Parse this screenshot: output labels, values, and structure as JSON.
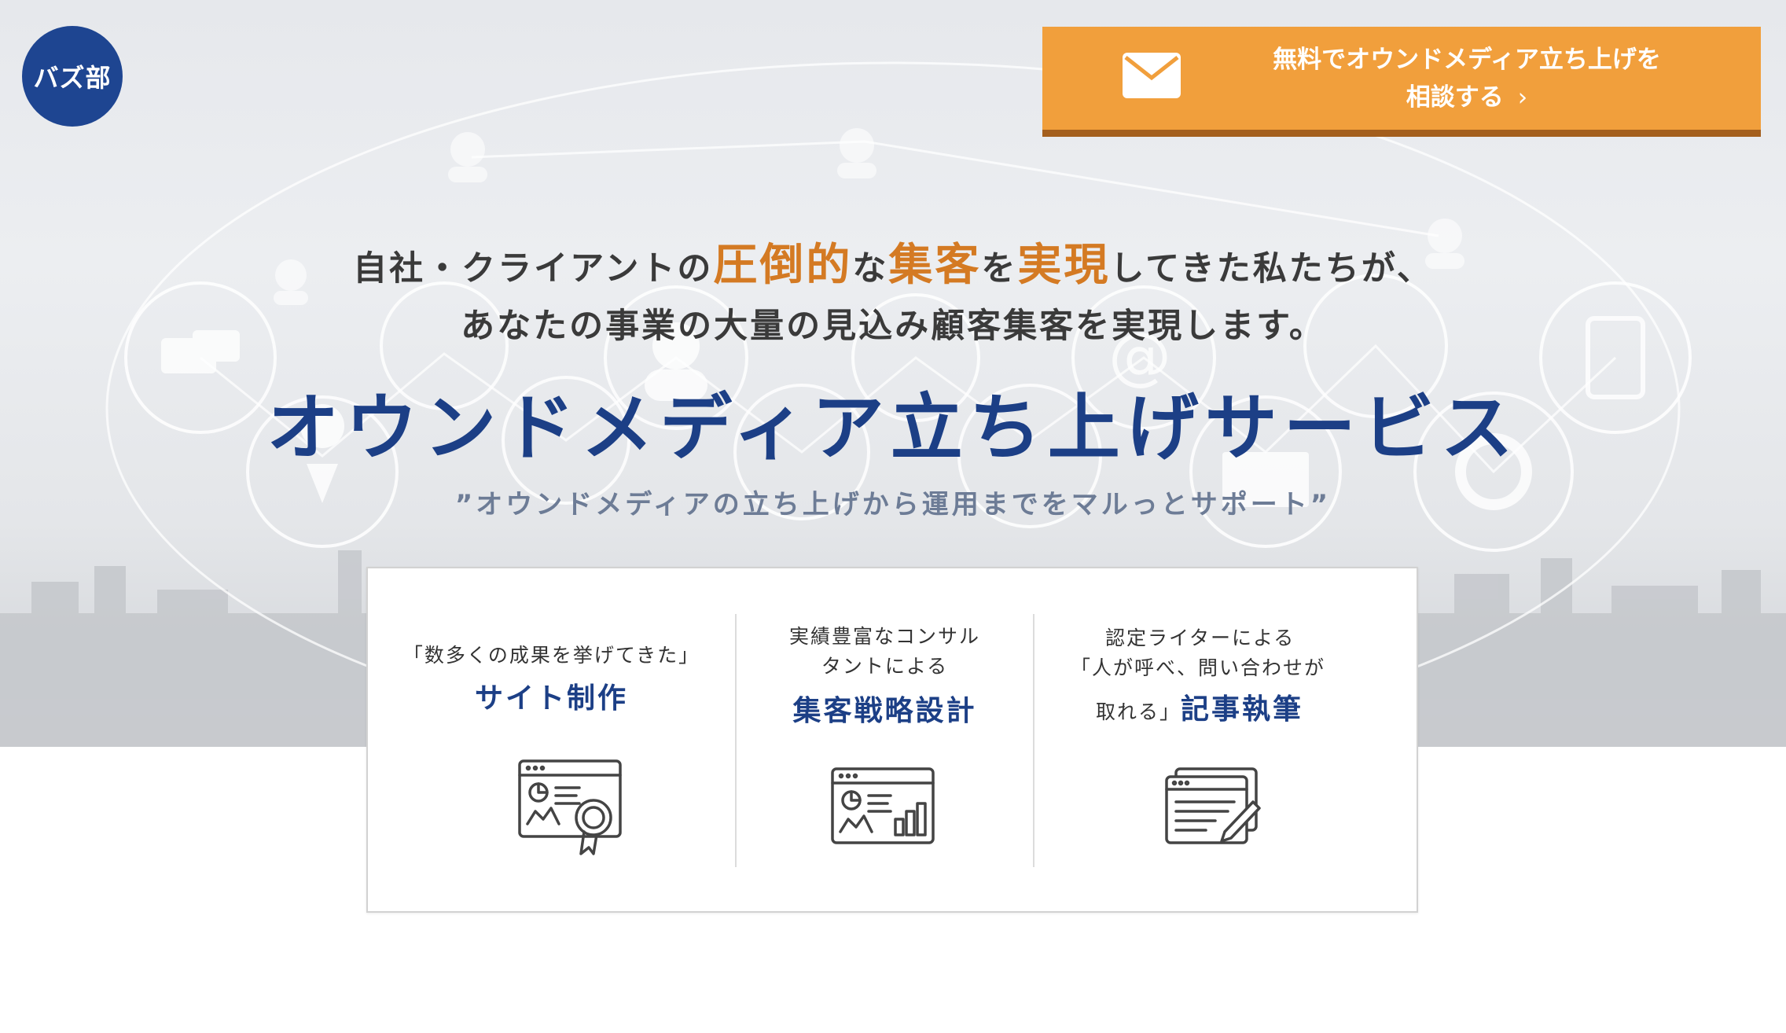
{
  "logo": {
    "text": "バズ部"
  },
  "cta": {
    "line1": "無料でオウンドメディア立ち上げを",
    "line2": "相談する",
    "chevron": "›",
    "icon": "mail-icon",
    "color": "#f19f3c"
  },
  "headline": {
    "line1": {
      "p1": "自社・クライアントの",
      "h1": "圧倒的",
      "p2": "な",
      "h2": "集客",
      "p3": "を",
      "h3": "実現",
      "p4": "してきた私たちが、"
    },
    "line2": "あなたの事業の大量の見込み顧客集客を実現します。",
    "highlight_color": "#d47a23"
  },
  "title": "オウンドメディア立ち上げサービス",
  "subtitle": "”オウンドメディアの立ち上げから運用までをマルっとサポート”",
  "services": [
    {
      "small1": "「数多くの成果を挙げてきた」",
      "title": "サイト制作",
      "icon": "website-certificate-icon"
    },
    {
      "small1": "実績豊富なコンサル",
      "small2": "タントによる",
      "title": "集客戦略設計",
      "icon": "analytics-dashboard-icon"
    },
    {
      "small1": "認定ライターによる",
      "small2": "「人が呼べ、問い合わせが",
      "small3": "取れる」",
      "title": "記事執筆",
      "icon": "document-writing-icon"
    }
  ],
  "colors": {
    "brand_navy": "#1c3f86",
    "logo_bg": "#1e4591",
    "accent_orange": "#f19f3c"
  }
}
